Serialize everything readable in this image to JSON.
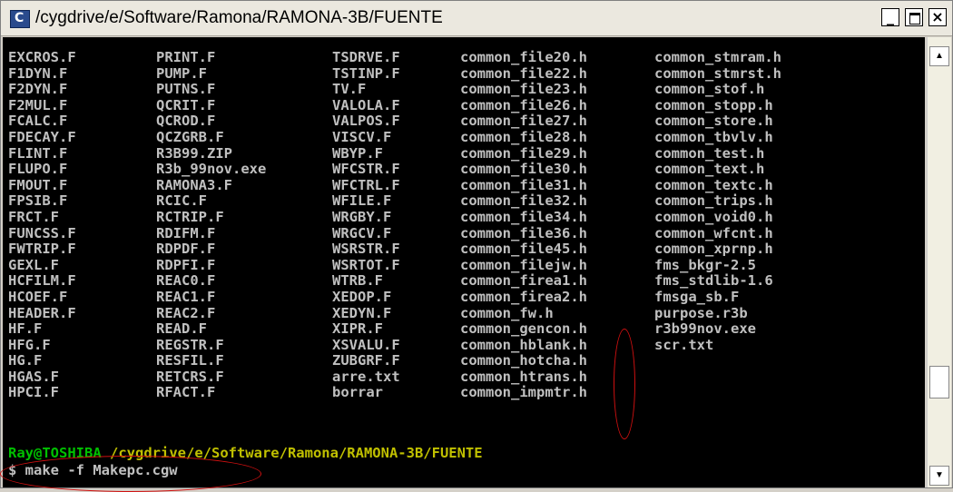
{
  "window": {
    "title": "/cygdrive/e/Software/Ramona/RAMONA-3B/FUENTE",
    "controls": {
      "minimize": "_",
      "close": "×"
    }
  },
  "terminal": {
    "columns": [
      [
        "EXCROS.F",
        "F1DYN.F",
        "F2DYN.F",
        "F2MUL.F",
        "FCALC.F",
        "FDECAY.F",
        "FLINT.F",
        "FLUPO.F",
        "FMOUT.F",
        "FPSIB.F",
        "FRCT.F",
        "FUNCSS.F",
        "FWTRIP.F",
        "GEXL.F",
        "HCFILM.F",
        "HCOEF.F",
        "HEADER.F",
        "HF.F",
        "HFG.F",
        "HG.F",
        "HGAS.F",
        "HPCI.F"
      ],
      [
        "PRINT.F",
        "PUMP.F",
        "PUTNS.F",
        "QCRIT.F",
        "QCROD.F",
        "QCZGRB.F",
        "R3B99.ZIP",
        "R3b_99nov.exe",
        "RAMONA3.F",
        "RCIC.F",
        "RCTRIP.F",
        "RDIFM.F",
        "RDPDF.F",
        "RDPFI.F",
        "REAC0.F",
        "REAC1.F",
        "REAC2.F",
        "READ.F",
        "REGSTR.F",
        "RESFIL.F",
        "RETCRS.F",
        "RFACT.F"
      ],
      [
        "TSDRVE.F",
        "TSTINP.F",
        "TV.F",
        "VALOLA.F",
        "VALPOS.F",
        "VISCV.F",
        "WBYP.F",
        "WFCSTR.F",
        "WFCTRL.F",
        "WFILE.F",
        "WRGBY.F",
        "WRGCV.F",
        "WSRSTR.F",
        "WSRTOT.F",
        "WTRB.F",
        "XEDOP.F",
        "XEDYN.F",
        "XIPR.F",
        "XSVALU.F",
        "ZUBGRF.F",
        "arre.txt",
        "borrar"
      ],
      [
        "common_file20.h",
        "common_file22.h",
        "common_file23.h",
        "common_file26.h",
        "common_file27.h",
        "common_file28.h",
        "common_file29.h",
        "common_file30.h",
        "common_file31.h",
        "common_file32.h",
        "common_file34.h",
        "common_file36.h",
        "common_file45.h",
        "common_filejw.h",
        "common_firea1.h",
        "common_firea2.h",
        "common_fw.h",
        "common_gencon.h",
        "common_hblank.h",
        "common_hotcha.h",
        "common_htrans.h",
        "common_impmtr.h"
      ],
      [
        "common_stmram.h",
        "common_stmrst.h",
        "common_stof.h",
        "common_stopp.h",
        "common_store.h",
        "common_tbvlv.h",
        "common_test.h",
        "common_text.h",
        "common_textc.h",
        "common_trips.h",
        "common_void0.h",
        "common_wfcnt.h",
        "common_xprnp.h",
        "fms_bkgr-2.5",
        "fms_stdlib-1.6",
        "fmsga_sb.F",
        "purpose.r3b",
        "r3b99nov.exe",
        "scr.txt"
      ]
    ],
    "prompt_user": "Ray@TOSHIBA",
    "prompt_path": "/cygdrive/e/Software/Ramona/RAMONA-3B/FUENTE",
    "command": "$ make -f Makepc.cgw"
  },
  "colors": {
    "annotation": "#d01010",
    "prompt_user": "#00c000",
    "prompt_path": "#c0c000"
  }
}
